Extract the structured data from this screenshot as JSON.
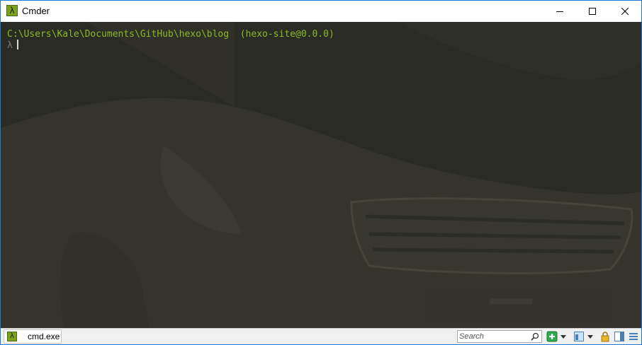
{
  "window": {
    "title": "Cmder",
    "app_icon_glyph": "λ",
    "accent_color": "#1e78d7",
    "controls": [
      "minimize",
      "maximize",
      "close"
    ]
  },
  "console": {
    "background_color": "#2b2b25",
    "path_line": "C:\\Users\\Kale\\Documents\\GitHub\\hexo\\blog  (hexo-site@0.0.0)",
    "path_color": "#89ba22",
    "prompt_symbol": "λ",
    "prompt_color": "#7c7d72",
    "input_text": ""
  },
  "statusbar": {
    "tab": {
      "icon_glyph": "λ",
      "label": "cmd.exe"
    },
    "search": {
      "placeholder": "Search"
    },
    "icons": [
      "new-console-icon",
      "dropdown-arrow-icon",
      "pane-icon",
      "dropdown-arrow-icon",
      "lock-icon",
      "split-view-icon",
      "menu-icon"
    ]
  }
}
